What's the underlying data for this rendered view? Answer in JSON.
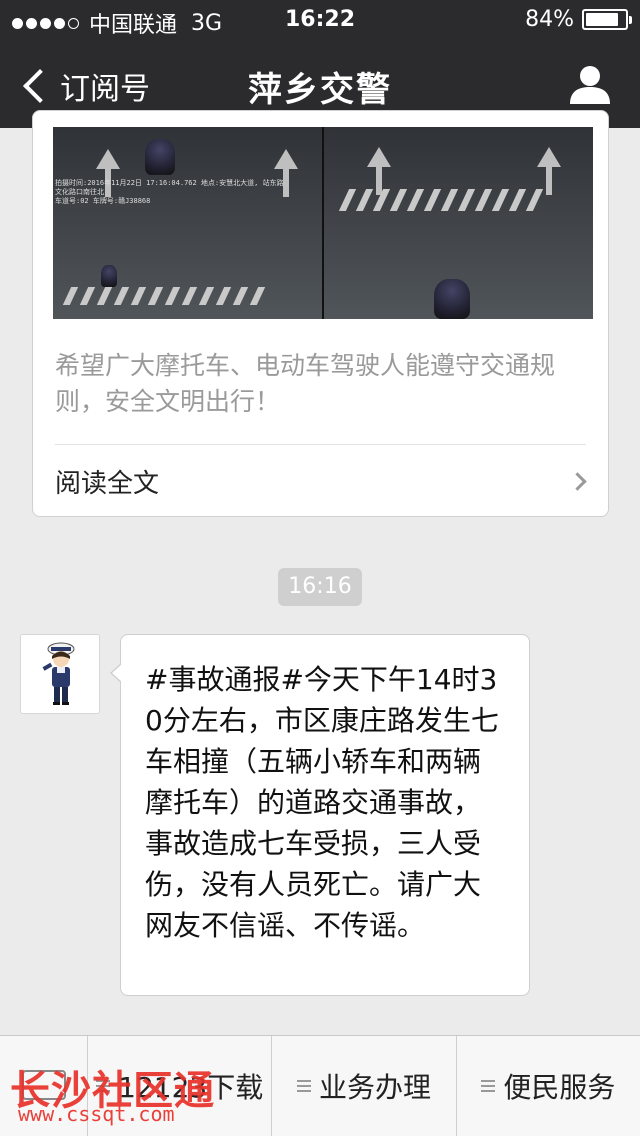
{
  "status_bar": {
    "carrier": "中国联通",
    "network": "3G",
    "time": "16:22",
    "battery": "84%",
    "battery_level": 0.84
  },
  "nav": {
    "back_label": "订阅号",
    "title": "萍乡交警",
    "profile_icon": "person-icon"
  },
  "article": {
    "photo_stamp_line1": "拍摄时间:2016年11月22日 17:16:04.762 地点:安慧北大道, 站东路",
    "photo_stamp_line2": "文化路口南往北",
    "photo_stamp_line3": "车道号:02 车牌号:赣J38868",
    "summary": "希望广大摩托车、电动车驾驶人能遵守交通规则，安全文明出行！",
    "read_more": "阅读全文"
  },
  "time_divider": "16:16",
  "message": {
    "text": "#事故通报#今天下午14时30分左右，市区康庄路发生七车相撞（五辆小轿车和两辆摩托车）的道路交通事故，事故造成七车受损，三人受伤，没有人员死亡。请广大网友不信谣、不传谣。"
  },
  "menu": {
    "items": [
      {
        "label": "12123下载",
        "icon": "menu-lines-icon"
      },
      {
        "label": "业务办理",
        "icon": "menu-lines-icon"
      },
      {
        "label": "便民服务",
        "icon": "menu-lines-icon"
      }
    ],
    "keyboard_icon": "keyboard-icon"
  },
  "watermark": {
    "text": "长沙社区通",
    "url": "www.cssqt.com"
  },
  "colors": {
    "header_bg": "#2b2b2e",
    "page_bg": "#ebebeb",
    "watermark": "#e8322b"
  }
}
